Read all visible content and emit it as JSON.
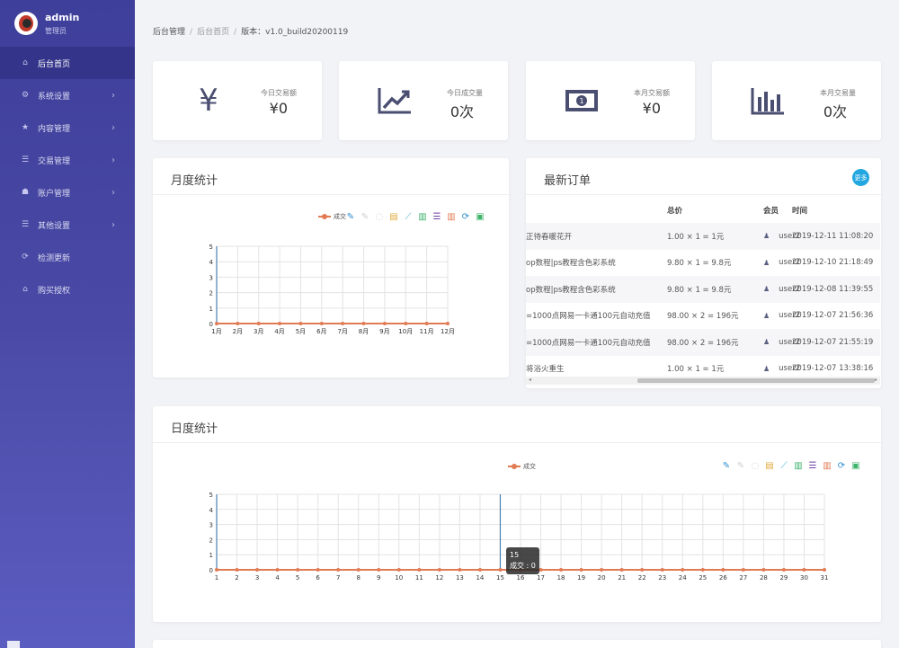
{
  "user": {
    "name": "admin",
    "role": "管理员"
  },
  "sidebar": {
    "items": [
      {
        "label": "后台首页",
        "icon": "home-icon",
        "glyph": "⌂",
        "active": true,
        "chevron": false
      },
      {
        "label": "系统设置",
        "icon": "gear-icon",
        "glyph": "⚙",
        "active": false,
        "chevron": true
      },
      {
        "label": "内容管理",
        "icon": "star-icon",
        "glyph": "★",
        "active": false,
        "chevron": true
      },
      {
        "label": "交易管理",
        "icon": "list-icon",
        "glyph": "☰",
        "active": false,
        "chevron": true
      },
      {
        "label": "账户管理",
        "icon": "users-icon",
        "glyph": "☗",
        "active": false,
        "chevron": true
      },
      {
        "label": "其他设置",
        "icon": "list-icon",
        "glyph": "☰",
        "active": false,
        "chevron": true
      },
      {
        "label": "检测更新",
        "icon": "refresh-icon",
        "glyph": "⟳",
        "active": false,
        "chevron": false
      },
      {
        "label": "购买授权",
        "icon": "home-icon",
        "glyph": "⌂",
        "active": false,
        "chevron": false
      }
    ],
    "chevron": "›"
  },
  "breadcrumb": {
    "root": "后台管理",
    "current": "后台首页",
    "version": "版本：v1.0_build20200119",
    "sep": "/"
  },
  "stats": [
    {
      "label": "今日交易额",
      "value": "¥0",
      "icon": "yen-icon"
    },
    {
      "label": "今日成交量",
      "value": "0次",
      "icon": "trend-chart-icon"
    },
    {
      "label": "本月交易额",
      "value": "¥0",
      "icon": "banknote-icon"
    },
    {
      "label": "本月交易量",
      "value": "0次",
      "icon": "bar-chart-icon"
    }
  ],
  "monthly": {
    "title": "月度统计",
    "legend": "成交"
  },
  "daily": {
    "title": "日度统计",
    "legend": "成交"
  },
  "orders": {
    "title": "最新订单",
    "more": "更多",
    "columns": {
      "price": "总价",
      "user": "会员",
      "time": "时间"
    },
    "rows": [
      {
        "name": "正待春暖花开",
        "price": "1.00 × 1 = 1元",
        "user": "user2",
        "time": "2019-12-11 11:08:20"
      },
      {
        "name": "op数程|ps教程含色彩系统",
        "price": "9.80 × 1 = 9.8元",
        "user": "user2",
        "time": "2019-12-10 21:18:49"
      },
      {
        "name": "op数程|ps教程含色彩系统",
        "price": "9.80 × 1 = 9.8元",
        "user": "user2",
        "time": "2019-12-08 11:39:55"
      },
      {
        "name": "=1000点网易一卡通100元自动充值",
        "price": "98.00 × 2 = 196元",
        "user": "user2",
        "time": "2019-12-07 21:56:36"
      },
      {
        "name": "=1000点网易一卡通100元自动充值",
        "price": "98.00 × 2 = 196元",
        "user": "user2",
        "time": "2019-12-07 21:55:19"
      },
      {
        "name": "将浴火重生",
        "price": "1.00 × 1 = 1元",
        "user": "user2",
        "time": "2019-12-07 13:38:16"
      }
    ]
  },
  "tooltip": {
    "title": "15",
    "line": "成交 : 0"
  },
  "colors": {
    "accent": "#e07b53",
    "sidebar": "#4a4aa6",
    "more": "#22a7e0"
  },
  "chart_data": [
    {
      "type": "line",
      "x": [
        "1月",
        "2月",
        "3月",
        "4月",
        "5月",
        "6月",
        "7月",
        "8月",
        "9月",
        "10月",
        "11月",
        "12月"
      ],
      "series": [
        {
          "name": "成交",
          "values": [
            0,
            0,
            0,
            0,
            0,
            0,
            0,
            0,
            0,
            0,
            0,
            0
          ]
        }
      ],
      "ylim": [
        0,
        5
      ],
      "yticks": [
        "0",
        "1",
        "2",
        "3",
        "4",
        "5"
      ],
      "grid": true,
      "legend": "top-right"
    },
    {
      "type": "line",
      "x": [
        "1",
        "2",
        "3",
        "4",
        "5",
        "6",
        "7",
        "8",
        "9",
        "10",
        "11",
        "12",
        "13",
        "14",
        "15",
        "16",
        "17",
        "18",
        "19",
        "20",
        "21",
        "22",
        "23",
        "24",
        "25",
        "26",
        "27",
        "28",
        "29",
        "30",
        "31"
      ],
      "series": [
        {
          "name": "成交",
          "values": [
            0,
            0,
            0,
            0,
            0,
            0,
            0,
            0,
            0,
            0,
            0,
            0,
            0,
            0,
            0,
            0,
            0,
            0,
            0,
            0,
            0,
            0,
            0,
            0,
            0,
            0,
            0,
            0,
            0,
            0,
            0
          ]
        }
      ],
      "ylim": [
        0,
        5
      ],
      "yticks": [
        "0",
        "1",
        "2",
        "3",
        "4",
        "5"
      ],
      "grid": true,
      "legend": "top-center"
    }
  ]
}
